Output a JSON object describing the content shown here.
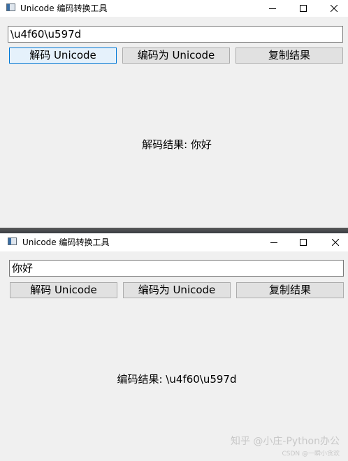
{
  "windows": [
    {
      "title": "Unicode 编码转换工具",
      "input_value": "\\u4f60\\u597d",
      "buttons": {
        "decode": "解码 Unicode",
        "encode": "编码为 Unicode",
        "copy": "复制结果"
      },
      "result": "解码结果: 你好"
    },
    {
      "title": "Unicode 编码转换工具",
      "input_value": "你好",
      "buttons": {
        "decode": "解码 Unicode",
        "encode": "编码为 Unicode",
        "copy": "复制结果"
      },
      "result": "编码结果: \\u4f60\\u597d"
    }
  ],
  "watermark": {
    "main": "知乎 @小庄-Python办公",
    "sub": "CSDN @一瞬小贪欢"
  },
  "icons": [
    "app-icon",
    "minimize-icon",
    "maximize-icon",
    "close-icon"
  ],
  "colors": {
    "window_bg": "#f0f0f0",
    "titlebar_bg": "#ffffff",
    "button_bg": "#e1e1e1",
    "focus_border": "#0078d7"
  }
}
